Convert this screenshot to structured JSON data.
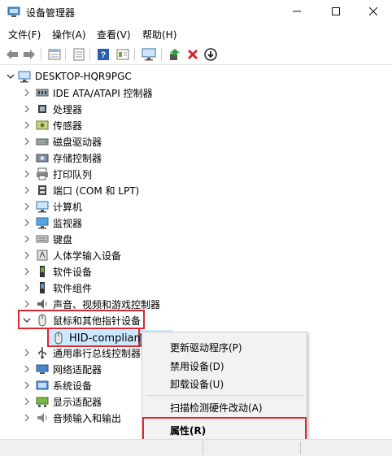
{
  "window": {
    "title": "设备管理器"
  },
  "menu": [
    "文件(F)",
    "操作(A)",
    "查看(V)",
    "帮助(H)"
  ],
  "toolbar_icons": [
    "back-arrow-icon",
    "forward-arrow-icon",
    "properties-icon",
    "refresh-icon",
    "help-icon",
    "view-icon",
    "monitor-icon",
    "update-driver-icon",
    "uninstall-icon",
    "download-icon"
  ],
  "tree": {
    "root": "DESKTOP-HQR9PGC",
    "categories": [
      {
        "label": "IDE ATA/ATAPI 控制器",
        "icon": "ide-controller-icon"
      },
      {
        "label": "处理器",
        "icon": "processor-icon"
      },
      {
        "label": "传感器",
        "icon": "sensor-icon"
      },
      {
        "label": "磁盘驱动器",
        "icon": "disk-drive-icon"
      },
      {
        "label": "存储控制器",
        "icon": "storage-controller-icon"
      },
      {
        "label": "打印队列",
        "icon": "printer-icon"
      },
      {
        "label": "端口 (COM 和 LPT)",
        "icon": "port-icon"
      },
      {
        "label": "计算机",
        "icon": "computer-icon"
      },
      {
        "label": "监视器",
        "icon": "monitor-icon"
      },
      {
        "label": "键盘",
        "icon": "keyboard-icon"
      },
      {
        "label": "人体学输入设备",
        "icon": "hid-icon"
      },
      {
        "label": "软件设备",
        "icon": "software-device-icon"
      },
      {
        "label": "软件组件",
        "icon": "software-component-icon"
      },
      {
        "label": "声音、视频和游戏控制器",
        "icon": "sound-icon"
      },
      {
        "label": "鼠标和其他指针设备",
        "icon": "mouse-icon",
        "expanded": true
      },
      {
        "label": "通用串行总线控制器",
        "icon": "usb-icon"
      },
      {
        "label": "网络适配器",
        "icon": "network-icon"
      },
      {
        "label": "系统设备",
        "icon": "system-device-icon"
      },
      {
        "label": "显示适配器",
        "icon": "display-adapter-icon"
      },
      {
        "label": "音频输入和输出",
        "icon": "audio-icon"
      }
    ],
    "child": "HID-compliant"
  },
  "context_menu": {
    "items": [
      "更新驱动程序(P)",
      "禁用设备(D)",
      "卸载设备(U)",
      "扫描检测硬件改动(A)",
      "属性(R)"
    ]
  },
  "colors": {
    "highlight": "#e0262d",
    "selection": "#cce8ff"
  }
}
